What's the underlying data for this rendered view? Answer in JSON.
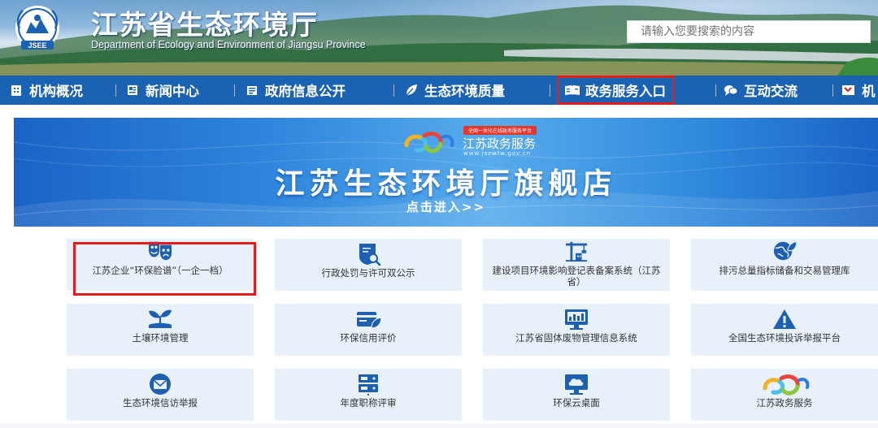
{
  "header": {
    "title": "江苏省生态环境厅",
    "subtitle": "Department of Ecology and Environment of Jiangsu Province",
    "logo_text": "JSEE",
    "search_placeholder": "请输入您要搜索的内容"
  },
  "nav": {
    "items": [
      {
        "label": "机构概况",
        "icon": "building-icon"
      },
      {
        "label": "新闻中心",
        "icon": "newspaper-icon"
      },
      {
        "label": "政府信息公开",
        "icon": "document-icon"
      },
      {
        "label": "生态环境质量",
        "icon": "leaf-icon"
      },
      {
        "label": "政务服务入口",
        "icon": "service-book-icon",
        "highlighted": true
      },
      {
        "label": "互动交流",
        "icon": "chat-bubble-icon"
      },
      {
        "label": "机",
        "icon": "flag-icon"
      }
    ]
  },
  "banner": {
    "platform_tag": "全国一体化在线政务服务平台",
    "brand_name": "江苏政务服务",
    "brand_url": "www.jszwfw.gov.cn",
    "title": "江苏生态环境厅旗舰店",
    "enter": "点击进入>>"
  },
  "tiles": [
    {
      "label": "江苏企业“环保脸谱”（一企一档）",
      "icon": "theater-mask-icon",
      "highlighted": true
    },
    {
      "label": "行政处罚与许可双公示",
      "icon": "certificate-search-icon"
    },
    {
      "label": "建设项目环境影响登记表备案系统（江苏省）",
      "icon": "construction-crane-icon"
    },
    {
      "label": "排污总量指标储备和交易管理库",
      "icon": "globe-leaf-icon"
    },
    {
      "label": "土壤环境管理",
      "icon": "seedling-icon"
    },
    {
      "label": "环保信用评价",
      "icon": "credit-card-leaf-icon"
    },
    {
      "label": "江苏省固体废物管理信息系统",
      "icon": "monitor-icon"
    },
    {
      "label": "全国生态环境投诉举报平台",
      "icon": "warning-triangle-icon"
    },
    {
      "label": "生态环境信访举报",
      "icon": "mail-circle-icon"
    },
    {
      "label": "年度职称评审",
      "icon": "server-rack-icon"
    },
    {
      "label": "环保云桌面",
      "icon": "cloud-desktop-icon"
    },
    {
      "label": "江苏政务服务",
      "icon": "jszw-logo-icon"
    }
  ],
  "colors": {
    "nav_bg": "#1b62b3",
    "highlight": "#e11d20",
    "tile_bg": "#e8f1fa",
    "icon_blue": "#1e5fb0"
  }
}
